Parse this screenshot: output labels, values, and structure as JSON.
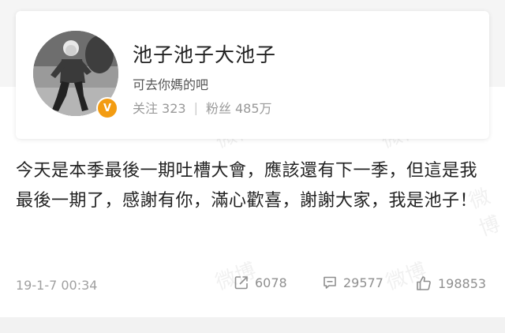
{
  "profile": {
    "username": "池子池子大池子",
    "bio": "可去你媽的吧",
    "verified_badge": "V",
    "following_label": "关注",
    "following_count": "323",
    "stats_separator": "|",
    "followers_label": "粉丝",
    "followers_count": "485万",
    "avatar_icon": "avatar-photo",
    "badge_color": "#f39c12"
  },
  "post": {
    "text": "今天是本季最後一期吐槽大會，應該還有下一季，但這是我最後一期了，感謝有你，滿心歡喜，謝謝大家，我是池子！"
  },
  "footer": {
    "timestamp": "19-1-7 00:34",
    "repost_count": "6078",
    "comment_count": "29577",
    "like_count": "198853",
    "repost_icon": "share-icon",
    "comment_icon": "comment-icon",
    "like_icon": "thumbs-up-icon"
  },
  "watermark": {
    "text": "微博"
  }
}
